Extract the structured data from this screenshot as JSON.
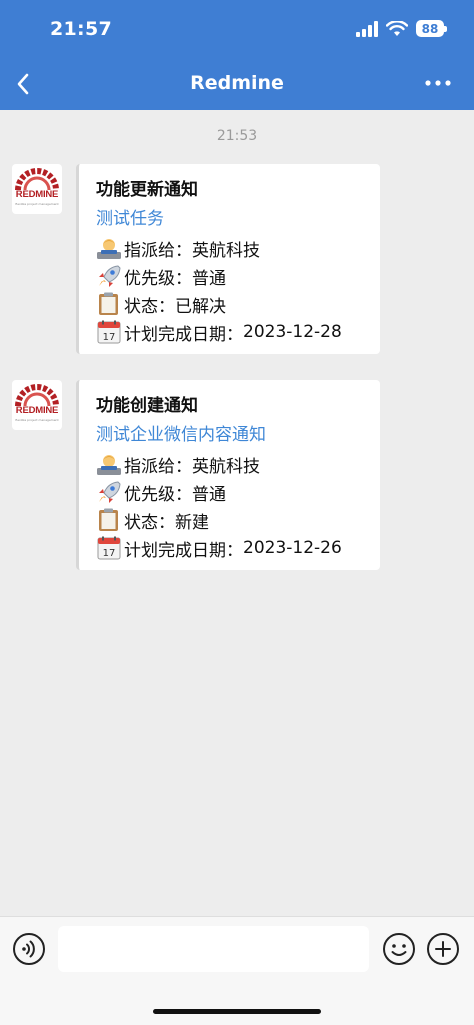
{
  "status_bar": {
    "time": "21:57",
    "battery": "88"
  },
  "nav": {
    "title": "Redmine"
  },
  "chat": {
    "timestamp": "21:53",
    "avatar": {
      "word": "REDMINE",
      "tagline": "flexible project management"
    },
    "messages": [
      {
        "title": "功能更新通知",
        "link": "测试任务",
        "rows": [
          {
            "icon": "technologist-icon",
            "label": "指派给：",
            "value": "英航科技"
          },
          {
            "icon": "rocket-icon",
            "label": "优先级：",
            "value": "普通"
          },
          {
            "icon": "clipboard-icon",
            "label": "状态：",
            "value": "已解决"
          },
          {
            "icon": "calendar-icon",
            "label": "计划完成日期：",
            "value": "2023-12-28"
          }
        ]
      },
      {
        "title": "功能创建通知",
        "link": "测试企业微信内容通知",
        "rows": [
          {
            "icon": "technologist-icon",
            "label": "指派给：",
            "value": "英航科技"
          },
          {
            "icon": "rocket-icon",
            "label": "优先级：",
            "value": "普通"
          },
          {
            "icon": "clipboard-icon",
            "label": "状态：",
            "value": "新建"
          },
          {
            "icon": "calendar-icon",
            "label": "计划完成日期：",
            "value": "2023-12-26"
          }
        ]
      }
    ]
  },
  "input": {
    "placeholder": ""
  },
  "colors": {
    "header": "#3f7ed3",
    "link": "#3f87d6",
    "background": "#ededed"
  }
}
